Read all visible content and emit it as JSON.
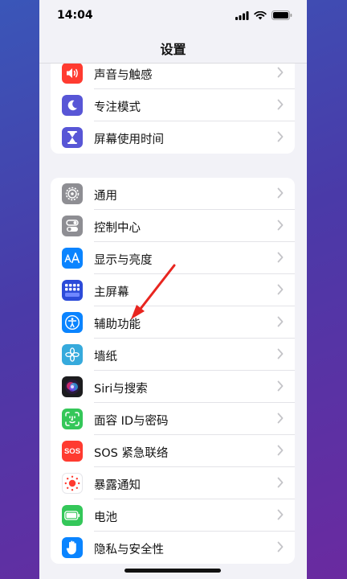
{
  "status_bar": {
    "time": "14:04"
  },
  "nav": {
    "title": "设置"
  },
  "groups": [
    {
      "items": [
        {
          "label": "声音与触感",
          "icon": "speaker-icon",
          "color": "#ff3b30"
        },
        {
          "label": "专注模式",
          "icon": "moon-icon",
          "color": "#5856d6"
        },
        {
          "label": "屏幕使用时间",
          "icon": "hourglass-icon",
          "color": "#5856d6"
        }
      ]
    },
    {
      "items": [
        {
          "label": "通用",
          "icon": "gear-icon",
          "color": "#8e8e93"
        },
        {
          "label": "控制中心",
          "icon": "toggles-icon",
          "color": "#8e8e93"
        },
        {
          "label": "显示与亮度",
          "icon": "text-size-icon",
          "color": "#0a84ff"
        },
        {
          "label": "主屏幕",
          "icon": "home-screen-icon",
          "color": "#2c4bd9"
        },
        {
          "label": "辅助功能",
          "icon": "accessibility-icon",
          "color": "#0a84ff"
        },
        {
          "label": "墙纸",
          "icon": "flower-icon",
          "color": "#36aadc"
        },
        {
          "label": "Siri与搜索",
          "icon": "siri-icon",
          "color": "#1c1c1e"
        },
        {
          "label": "面容 ID与密码",
          "icon": "face-id-icon",
          "color": "#34c759"
        },
        {
          "label": "SOS 紧急联络",
          "icon": "sos-icon",
          "color": "#ff3b30"
        },
        {
          "label": "暴露通知",
          "icon": "exposure-icon",
          "color": "#ffffff"
        },
        {
          "label": "电池",
          "icon": "battery-icon",
          "color": "#34c759"
        },
        {
          "label": "隐私与安全性",
          "icon": "hand-icon",
          "color": "#0a84ff"
        }
      ]
    }
  ],
  "sos_text": "SOS"
}
